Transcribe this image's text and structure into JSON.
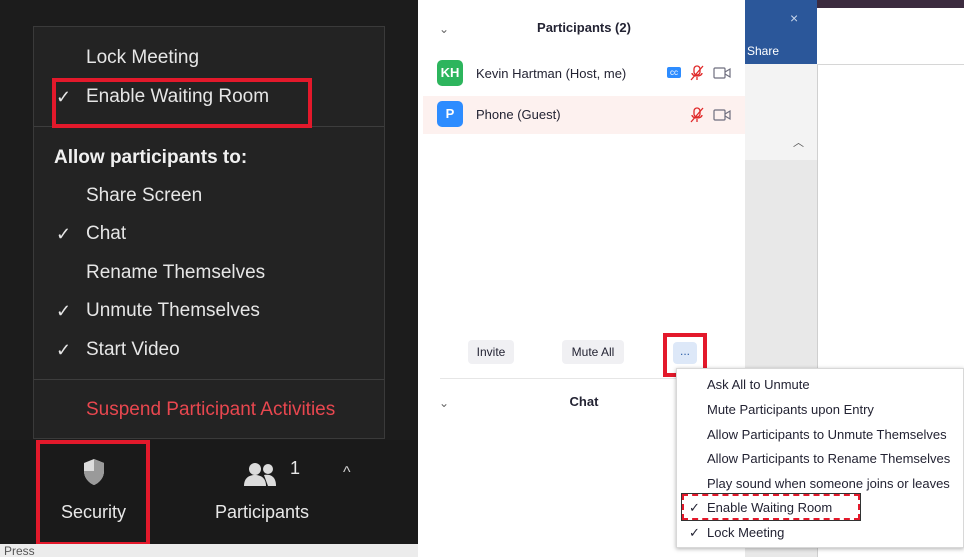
{
  "security_menu": {
    "items": [
      {
        "label": "Lock Meeting",
        "checked": false
      },
      {
        "label": "Enable Waiting Room",
        "checked": true
      }
    ],
    "section_header": "Allow participants to:",
    "permissions": [
      {
        "label": "Share Screen",
        "checked": false
      },
      {
        "label": "Chat",
        "checked": true
      },
      {
        "label": "Rename Themselves",
        "checked": false
      },
      {
        "label": "Unmute Themselves",
        "checked": true
      },
      {
        "label": "Start Video",
        "checked": true
      }
    ],
    "suspend_label": "Suspend Participant Activities",
    "check_glyph": "✓"
  },
  "toolbar": {
    "security_label": "Security",
    "participants_label": "Participants",
    "participants_count": "1",
    "caret": "^",
    "bottom_text_1": "Press"
  },
  "participants_panel": {
    "title": "Participants (2)",
    "participants": [
      {
        "initials": "KH",
        "name": "Kevin Hartman (Host, me)",
        "avatar_color": "#2db55d",
        "cc": "cc"
      },
      {
        "initials": "P",
        "name": "Phone (Guest)",
        "avatar_color": "#2d8cff"
      }
    ],
    "invite_label": "Invite",
    "mute_all_label": "Mute All",
    "more_label": "...",
    "chat_title": "Chat"
  },
  "more_menu": {
    "items": [
      {
        "label": "Ask All to Unmute",
        "checked": false
      },
      {
        "label": "Mute Participants upon Entry",
        "checked": false
      },
      {
        "label": "Allow Participants to Unmute Themselves",
        "checked": false
      },
      {
        "label": "Allow Participants to Rename Themselves",
        "checked": false
      },
      {
        "label": "Play sound when someone joins or leaves",
        "checked": false
      },
      {
        "label": "Enable Waiting Room",
        "checked": true
      },
      {
        "label": "Lock Meeting",
        "checked": true
      }
    ]
  },
  "background_window": {
    "share_label": "Share"
  },
  "colors": {
    "highlight_red": "#e3192b",
    "suspend_red": "#e8474f",
    "zoom_blue": "#2d8cff",
    "mic_muted_red": "#e02828"
  }
}
